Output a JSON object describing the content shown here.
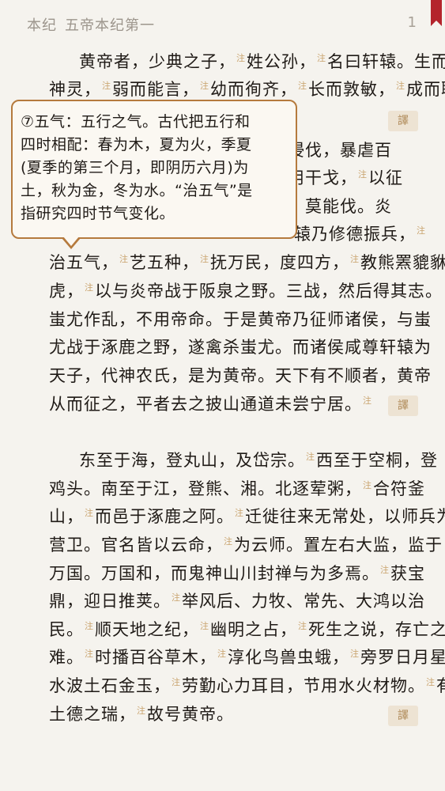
{
  "header": {
    "section": "本纪",
    "chapter": "五帝本纪第一",
    "page": "1"
  },
  "note_marker": "注",
  "translate_label": "譯",
  "popup": {
    "text": "⑦五气：五行之气。古代把五行和\n四时相配：春为木，夏为火，季夏\n(夏季的第三个月，即阴历六月)为\n土，秋为金，冬为水。“治五气”是\n指研究四时节气变化。"
  },
  "paragraph1": {
    "l1": [
      "黄帝者，少典之子，",
      "姓公孙，",
      "名曰轩辕。生而"
    ],
    "l2": [
      "神灵，",
      "弱而能言，",
      "幼而徇齐，",
      "长而敦敏，",
      "成而聪"
    ],
    "l4_tail": "相侵伐，暴虐百",
    "l5_tail": [
      "习用干戈，",
      "以征"
    ],
    "l6_tail": "暴，莫能伐。炎",
    "l7_tail": [
      "辕乃修德振兵，",
      ""
    ],
    "l8": [
      "治五气，",
      "艺五种，",
      "抚万民，度四方，",
      "教熊罴貔貅貙"
    ],
    "l9": [
      "虎，",
      "以与炎帝战于阪泉之野。三战，然后得其志。"
    ],
    "l10": "蚩尤作乱，不用帝命。于是黄帝乃征师诸侯，与蚩",
    "l11": "尤战于涿鹿之野，遂禽杀蚩尤。而诸侯咸尊轩辕为",
    "l12": "天子，代神农氏，是为黄帝。天下有不顺者，黄帝",
    "l13": [
      "从而征之，平者去之披山通道未尝宁居。",
      ""
    ]
  },
  "paragraph2": {
    "l1": [
      "东至于海，登丸山，及岱宗。",
      "西至于空桐，登"
    ],
    "l2": [
      "鸡头。南至于江，登熊、湘。北逐荤粥，",
      "合符釜"
    ],
    "l3": [
      "山，",
      "而邑于涿鹿之阿。",
      "迁徙往来无常处，以师兵为"
    ],
    "l4": [
      "营卫。官名皆以云命，",
      "为云师。置左右大监，监于"
    ],
    "l5": [
      "万国。万国和，而鬼神山川封禅与为多焉。",
      "获宝"
    ],
    "l6": [
      "鼎，迎日推荚。",
      "举风后、力牧、常先、大鸿以治"
    ],
    "l7": [
      "民。",
      "顺天地之纪，",
      "幽明之占，",
      "死生之说，存亡之"
    ],
    "l8": [
      "难。",
      "时播百谷草木，",
      "淳化鸟兽虫蛾，",
      "旁罗日月星辰"
    ],
    "l9": [
      "水波土石金玉，",
      "劳勤心力耳目，节用水火材物。",
      "有"
    ],
    "l10": [
      "土德之瑞，",
      "故号黄帝。"
    ]
  }
}
